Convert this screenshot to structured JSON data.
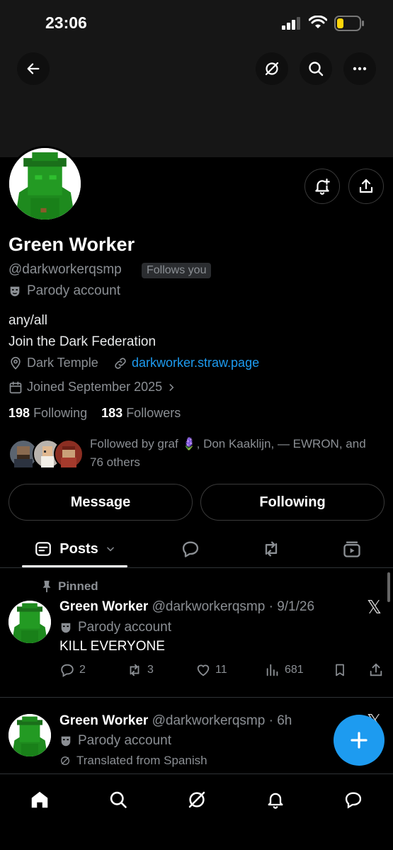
{
  "status": {
    "time": "23:06"
  },
  "header": {
    "back_icon": "arrow-left-icon",
    "grok_icon": "grok-icon",
    "search_icon": "search-icon",
    "more_icon": "more-icon"
  },
  "profile": {
    "name": "Green Worker",
    "handle": "@darkworkerqsmp",
    "follows_you": "Follows you",
    "parody_label": "Parody account",
    "bio_line1": "any/all",
    "bio_line2": "Join the Dark Federation",
    "location": "Dark Temple",
    "website": "darkworker.straw.page",
    "joined": "Joined September 2025",
    "following_count": "198",
    "following_label": "Following",
    "followers_count": "183",
    "followers_label": "Followers",
    "followed_by": "Followed by graf 🪻, Don Kaaklijn, — EWRON, and 76 others"
  },
  "buttons": {
    "message": "Message",
    "following": "Following"
  },
  "tabs": {
    "posts": "Posts"
  },
  "posts": [
    {
      "pinned_label": "Pinned",
      "name": "Green Worker",
      "handle_time": "@darkworkerqsmp · 9/1/26",
      "parody": "Parody account",
      "text": "KILL EVERYONE",
      "replies": "2",
      "reposts": "3",
      "likes": "11",
      "views": "681"
    },
    {
      "name": "Green Worker",
      "handle_time": "@darkworkerqsmp · 6h",
      "parody": "Parody account",
      "translated": "Translated from Spanish"
    }
  ],
  "colors": {
    "accent": "#1d9bf0",
    "muted": "#8b8f94",
    "background": "#000000",
    "avatar_green": "#1e8a1e"
  }
}
